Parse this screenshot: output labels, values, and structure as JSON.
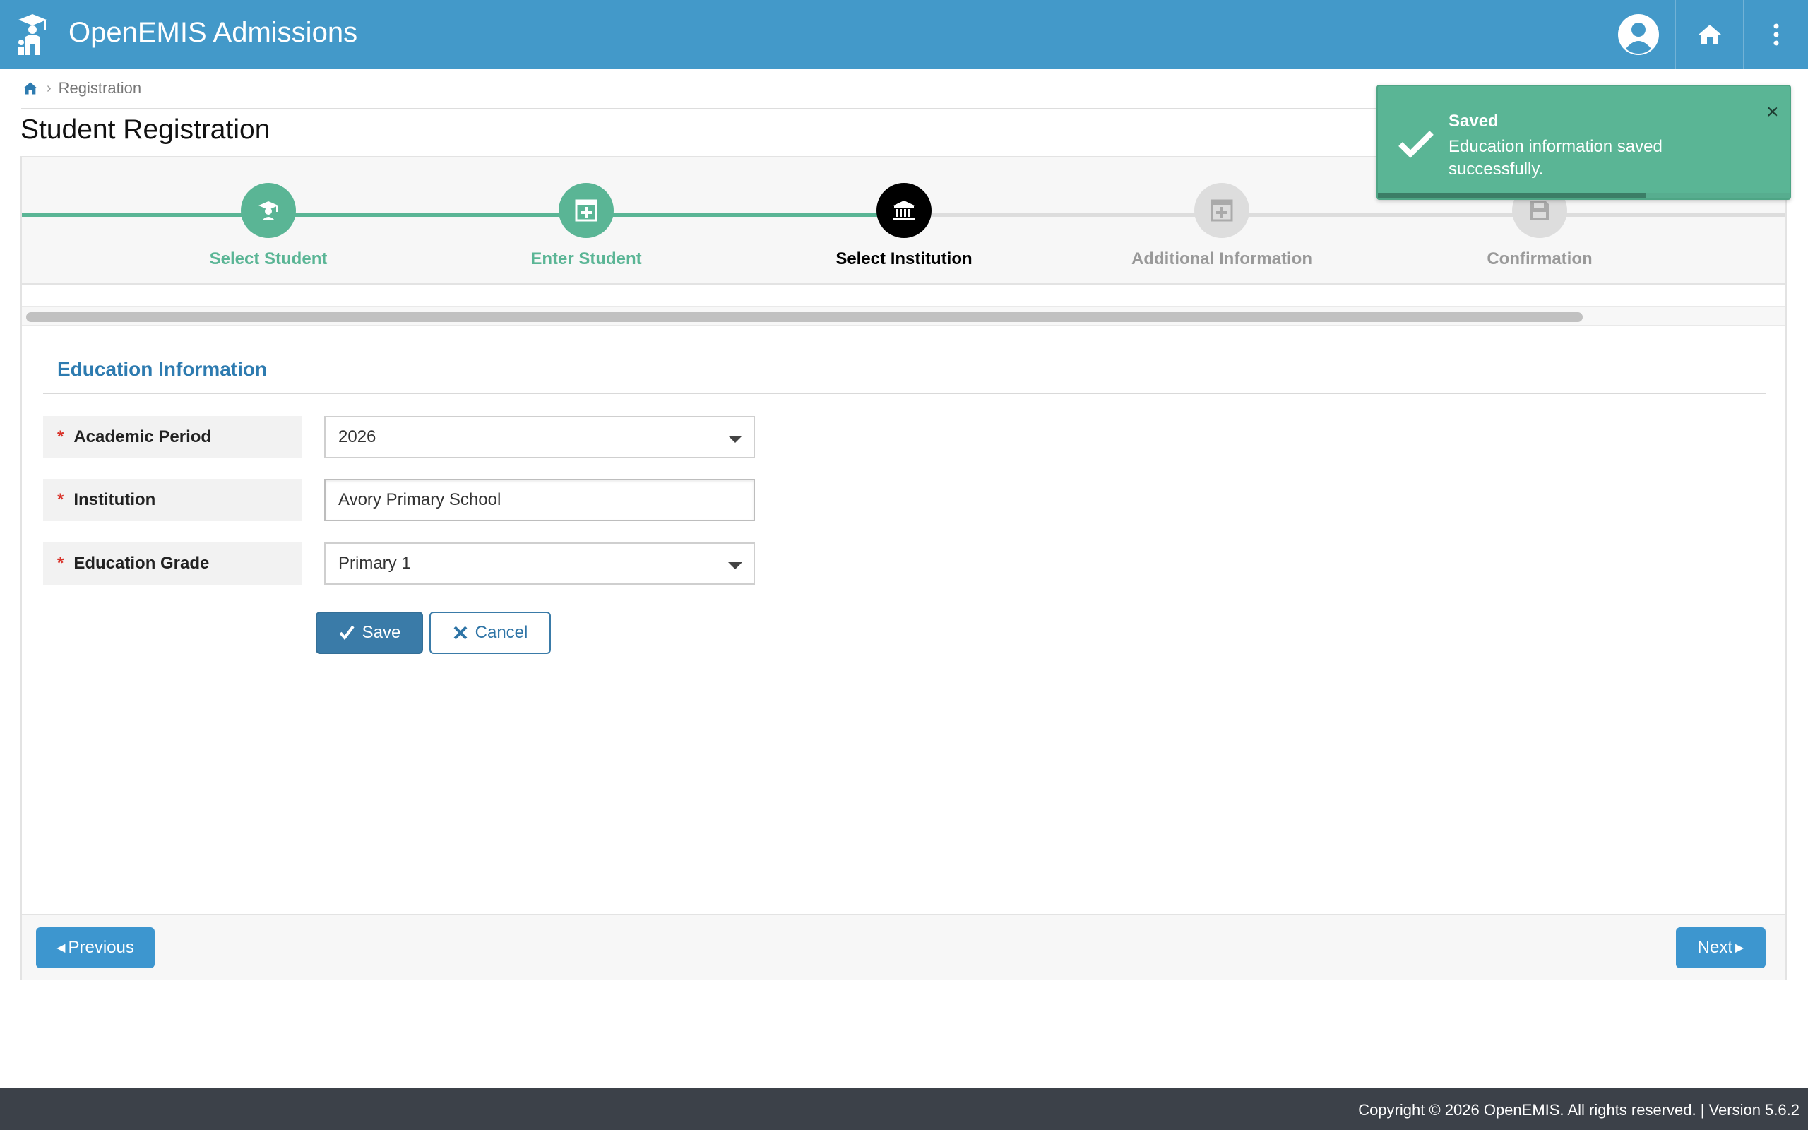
{
  "header": {
    "app_title": "OpenEMIS Admissions",
    "icons": {
      "logo": "openemis-logo",
      "user": "user-avatar-icon",
      "home": "home-icon",
      "menu": "vertical-dots-icon"
    },
    "color": "#4399c9"
  },
  "breadcrumb": {
    "home_icon": "home-icon",
    "items": [
      "Registration"
    ]
  },
  "page_title": "Student Registration",
  "wizard": {
    "steps": [
      {
        "label": "Select Student",
        "icon": "graduate-icon",
        "state": "complete"
      },
      {
        "label": "Enter Student",
        "icon": "plus-square-icon",
        "state": "complete"
      },
      {
        "label": "Select Institution",
        "icon": "institution-icon",
        "state": "active"
      },
      {
        "label": "Additional Information",
        "icon": "plus-square-icon",
        "state": "pending"
      },
      {
        "label": "Confirmation",
        "icon": "save-icon",
        "state": "pending"
      }
    ],
    "colors": {
      "complete": "#5ab595",
      "active": "#000000",
      "pending": "#dddddd"
    }
  },
  "form": {
    "section_title": "Education Information",
    "fields": [
      {
        "label": "Academic Period",
        "required": "*",
        "value": "2026",
        "type": "select"
      },
      {
        "label": "Institution",
        "required": "*",
        "value": "Avory Primary School",
        "type": "text"
      },
      {
        "label": "Education Grade",
        "required": "*",
        "value": "Primary 1",
        "type": "select"
      }
    ],
    "save_label": "Save",
    "cancel_label": "Cancel"
  },
  "navigation": {
    "previous_label": "Previous",
    "next_label": "Next"
  },
  "toast": {
    "title": "Saved",
    "message": "Education information saved successfully.",
    "progress": 0.65,
    "color": "#5ab595"
  },
  "footer": {
    "copyright": "Copyright © 2026 OpenEMIS. All rights reserved. | Version 5.6.2"
  }
}
